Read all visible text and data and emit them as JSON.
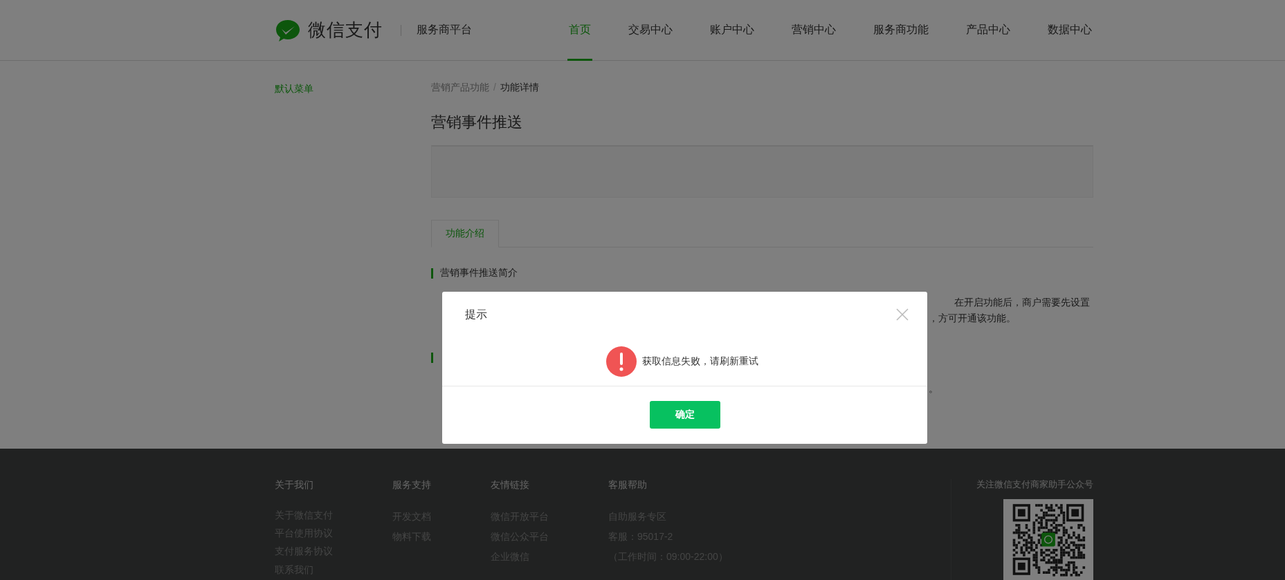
{
  "header": {
    "logo_text": "微信支付",
    "platform": "服务商平台",
    "nav": [
      {
        "label": "首页",
        "selected": true
      },
      {
        "label": "交易中心",
        "selected": false
      },
      {
        "label": "账户中心",
        "selected": false
      },
      {
        "label": "营销中心",
        "selected": false
      },
      {
        "label": "服务商功能",
        "selected": false
      },
      {
        "label": "产品中心",
        "selected": false
      },
      {
        "label": "数据中心",
        "selected": false
      }
    ]
  },
  "sidebar": {
    "items": [
      {
        "label": "默认菜单",
        "selected": true
      }
    ]
  },
  "breadcrumb": {
    "parent": "营销产品功能",
    "separator": "/",
    "current": "功能详情"
  },
  "page_title": "营销事件推送",
  "tabs": [
    {
      "label": "功能介绍",
      "selected": true
    }
  ],
  "sections": [
    {
      "heading": "营销事件推送简介",
      "lines": [
        {
          "kind": "far",
          "text": "在开启功能后，商户需要先设置"
        },
        {
          "kind": "near",
          "text": "，方可开通该功能。"
        }
      ]
    },
    {
      "lines": [
        {
          "kind": "near",
          "text": "。"
        }
      ]
    }
  ],
  "dialog": {
    "title": "提示",
    "message": "获取信息失败，请刷新重试",
    "button": "确定"
  },
  "footer": {
    "columns": [
      {
        "heading": "关于我们",
        "links": [
          "关于微信支付",
          "平台使用协议",
          "支付服务协议",
          "联系我们"
        ]
      },
      {
        "heading": "服务支持",
        "links": [
          "开发文档",
          "物料下载"
        ]
      },
      {
        "heading": "友情链接",
        "links": [
          "微信开放平台",
          "微信公众平台",
          "企业微信"
        ]
      },
      {
        "heading": "客服帮助",
        "links": [
          "自助服务专区",
          "客服：95017-2",
          "（工作时间：09:00-22:00）"
        ]
      }
    ],
    "qr_caption": "关注微信支付商家助手公众号"
  }
}
